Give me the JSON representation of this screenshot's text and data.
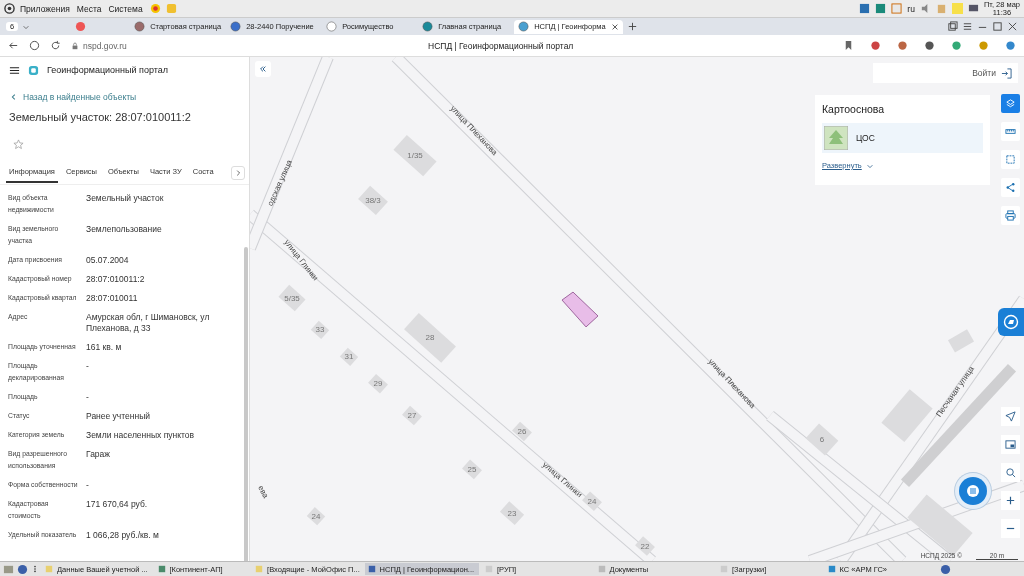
{
  "system_bar": {
    "menus": [
      "Приложения",
      "Места",
      "Система"
    ],
    "language": "ru",
    "date": "Пт, 28 мар",
    "time": "11:36"
  },
  "browser": {
    "tab_count": "6",
    "tabs": [
      {
        "title": "Стартовая страница",
        "selected": false
      },
      {
        "title": "28-2440 Поручение",
        "selected": false
      },
      {
        "title": "Росимущество",
        "selected": false
      },
      {
        "title": "Главная страница",
        "selected": false
      },
      {
        "title": "НСПД | Геоинформа",
        "selected": true
      }
    ],
    "address": "nspd.gov.ru",
    "page_title": "НСПД | Геоинформационный портал"
  },
  "panel": {
    "portal_name": "Геоинформационный портал",
    "back_link": "Назад в найденные объекты",
    "title": "Земельный участок: 28:07:010011:2",
    "favorite": false,
    "tabs": [
      {
        "label": "Информация",
        "selected": true
      },
      {
        "label": "Сервисы",
        "selected": false
      },
      {
        "label": "Объекты",
        "selected": false
      },
      {
        "label": "Части ЗУ",
        "selected": false
      },
      {
        "label": "Соста",
        "selected": false
      }
    ],
    "fields": [
      {
        "label": "Вид объекта недвижимости",
        "value": "Земельный участок"
      },
      {
        "label": "Вид земельного участка",
        "value": "Землепользование"
      },
      {
        "label": "Дата присвоения",
        "value": "05.07.2004"
      },
      {
        "label": "Кадастровый номер",
        "value": "28:07:010011:2"
      },
      {
        "label": "Кадастровый квартал",
        "value": "28:07:010011"
      },
      {
        "label": "Адрес",
        "value": "Амурская обл, г Шимановск, ул Плеханова, д 33"
      },
      {
        "label": "Площадь уточненная",
        "value": "161 кв. м"
      },
      {
        "label": "Площадь декларированная",
        "value": "-"
      },
      {
        "label": "Площадь",
        "value": "-"
      },
      {
        "label": "Статус",
        "value": "Ранее учтенный"
      },
      {
        "label": "Категория земель",
        "value": "Земли населенных пунктов"
      },
      {
        "label": "Вид разрешенного использования",
        "value": "Гараж"
      },
      {
        "label": "Форма собственности",
        "value": "-"
      },
      {
        "label": "Кадастровая стоимость",
        "value": "171 670,64 руб."
      },
      {
        "label": "Удельный показатель",
        "value": "1 066,28 руб./кв. м"
      }
    ]
  },
  "map": {
    "streets": [
      "улица Плеханова",
      "улица Плеханова",
      "одская улица",
      "улица Глинки",
      "улица Глинки",
      "Песчаная улица",
      "ева"
    ],
    "houses": [
      "1/35",
      "38/3",
      "5/35",
      "33",
      "31",
      "28",
      "29",
      "27",
      "26",
      "25",
      "24",
      "23",
      "22",
      "24",
      "6"
    ],
    "login": "Войти",
    "basemap": {
      "title": "Картооснова",
      "layers": [
        {
          "name": "ЦОС",
          "selected": true
        }
      ],
      "expand_link": "Развернуть"
    },
    "tools": [
      {
        "kind": "layers",
        "selected": true
      },
      {
        "kind": "ruler",
        "selected": false
      },
      {
        "kind": "select",
        "selected": false
      },
      {
        "kind": "share",
        "selected": false
      },
      {
        "kind": "print",
        "selected": false
      }
    ],
    "attribution": "НСПД 2025 ©",
    "scale": "20 m"
  },
  "taskbar": {
    "items": [
      {
        "label": "Данные Вашей учетной ...",
        "selected": false
      },
      {
        "label": "[Континент-АП]",
        "selected": false
      },
      {
        "label": "[Входящие - МойОфис П...",
        "selected": false
      },
      {
        "label": "НСПД | Геоинформацион...",
        "selected": true
      },
      {
        "label": "[РУП]",
        "selected": false
      },
      {
        "label": "Документы",
        "selected": false
      },
      {
        "label": "[Загрузки]",
        "selected": false
      },
      {
        "label": "КС «АРМ ГС»",
        "selected": false
      }
    ]
  }
}
